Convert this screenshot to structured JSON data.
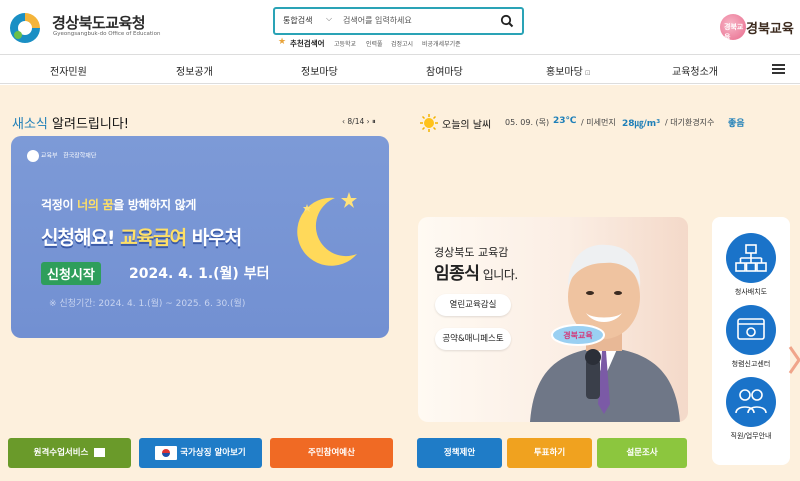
{
  "header": {
    "logo_title": "경상북도교육청",
    "logo_subtitle": "Gyeongsangbuk-do Office of Education",
    "brand_text": "경북교육",
    "brand_mark": "경북교육",
    "search": {
      "category": "통합검색",
      "placeholder": "검색어를 입력하세요"
    },
    "recommended_label": "추천검색어",
    "recommended": [
      "고등학교",
      "인력풀",
      "검정고시",
      "비공개세부기준"
    ]
  },
  "nav": {
    "items": [
      "전자민원",
      "정보공개",
      "정보마당",
      "참여마당",
      "홍보마당",
      "교육청소개"
    ],
    "ext_icon": "⊡"
  },
  "news": {
    "title_highlight": "새소식",
    "title_rest": " 알려드립니다!",
    "page": "8/14",
    "prev": "‹",
    "next": "›",
    "pause": "⏸"
  },
  "banner": {
    "logo1": "교육부",
    "logo2": "한국장학재단",
    "line1_a": "걱정이 ",
    "line1_b": "너의 꿈",
    "line1_c": "을 방해하지 않게",
    "line2_a": "신청해요! ",
    "line2_b": "교육급여",
    "line2_c": " 바우처",
    "start": "신청시작",
    "date": "2024. 4. 1.(월) 부터",
    "period": "※ 신청기간: 2024. 4. 1.(월) ~ 2025. 6. 30.(월)"
  },
  "quick_links": [
    {
      "label": "원격수업서비스",
      "color": "#6a9a2a"
    },
    {
      "label": "국가상징 알아보기",
      "color": "#1f7cc7"
    },
    {
      "label": "주민참여예산",
      "color": "#f06a24"
    }
  ],
  "weather": {
    "label": "오늘의 날씨",
    "date": "05. 09. (목)",
    "temp": "23℃",
    "dust_label": "/ 미세먼지",
    "dust_value": "28㎍/m³",
    "env_label": "/ 대기환경지수",
    "env_value": "좋음"
  },
  "superintendent": {
    "name_line1": "경상북도 교육감",
    "name_bold": "임종식",
    "name_suffix": " 입니다.",
    "buttons": [
      "열린교육감실",
      "공약&매니페스토"
    ]
  },
  "tools": [
    {
      "label": "정책제안",
      "color": "#1f7cc7"
    },
    {
      "label": "투표하기",
      "color": "#f0a21f"
    },
    {
      "label": "설문조사",
      "color": "#8cc63e"
    }
  ],
  "side_menu": [
    {
      "label": "청사배치도",
      "icon": "org-chart-icon"
    },
    {
      "label": "청렴신고센터",
      "icon": "report-center-icon"
    },
    {
      "label": "직원/업무안내",
      "icon": "staff-icon"
    }
  ]
}
